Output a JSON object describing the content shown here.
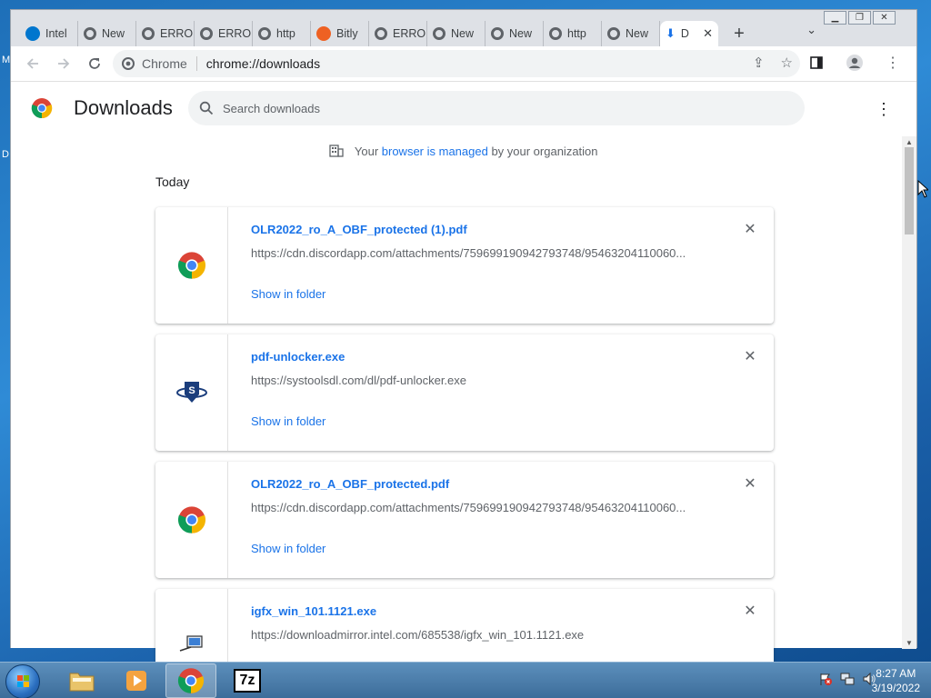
{
  "desktop": {
    "edge_labels": [
      "M",
      "D"
    ]
  },
  "window": {
    "controls": [
      "minimize",
      "maximize",
      "close"
    ],
    "tabs": [
      {
        "label": "Intel",
        "icon": "dell-icon",
        "color": "#0076ce"
      },
      {
        "label": "New",
        "icon": "chromium-icon",
        "color": "#5f6368"
      },
      {
        "label": "ERRO",
        "icon": "globe-icon",
        "color": "#5f6368"
      },
      {
        "label": "ERRO",
        "icon": "globe-icon",
        "color": "#5f6368"
      },
      {
        "label": "http",
        "icon": "globe-icon",
        "color": "#5f6368"
      },
      {
        "label": "Bitly",
        "icon": "bitly-icon",
        "color": "#ee6123"
      },
      {
        "label": "ERRO",
        "icon": "globe-icon",
        "color": "#5f6368"
      },
      {
        "label": "New",
        "icon": "chromium-icon",
        "color": "#5f6368"
      },
      {
        "label": "New",
        "icon": "chromium-icon",
        "color": "#5f6368"
      },
      {
        "label": "http",
        "icon": "globe-icon",
        "color": "#5f6368"
      },
      {
        "label": "New",
        "icon": "chromium-icon",
        "color": "#5f6368"
      }
    ],
    "active_tab": {
      "label": "D",
      "icon": "download-icon"
    },
    "new_tab_label": "+",
    "tab_search_label": "⌄"
  },
  "toolbar": {
    "omnibox": {
      "chip_label": "Chrome",
      "url": "chrome://downloads"
    }
  },
  "downloads": {
    "title": "Downloads",
    "search_placeholder": "Search downloads",
    "managed_prefix": "Your ",
    "managed_link": "browser is managed",
    "managed_suffix": " by your organization",
    "section_label": "Today",
    "items": [
      {
        "name": "OLR2022_ro_A_OBF_protected (1).pdf",
        "url": "https://cdn.discordapp.com/attachments/759699190942793748/95463204110060...",
        "action": "Show in folder",
        "icon": "chrome-icon"
      },
      {
        "name": "pdf-unlocker.exe",
        "url": "https://systoolsdl.com/dl/pdf-unlocker.exe",
        "action": "Show in folder",
        "icon": "systools-icon"
      },
      {
        "name": "OLR2022_ro_A_OBF_protected.pdf",
        "url": "https://cdn.discordapp.com/attachments/759699190942793748/95463204110060...",
        "action": "Show in folder",
        "icon": "chrome-icon"
      },
      {
        "name": "igfx_win_101.1121.exe",
        "url": "https://downloadmirror.intel.com/685538/igfx_win_101.1121.exe",
        "action": "",
        "icon": "installer-icon"
      }
    ]
  },
  "taskbar": {
    "items": [
      {
        "name": "explorer-icon"
      },
      {
        "name": "media-player-icon"
      },
      {
        "name": "chrome-icon",
        "active": true
      },
      {
        "name": "7zip-icon",
        "label": "7z"
      }
    ],
    "clock": {
      "time": "8:27 AM",
      "date": "3/19/2022"
    }
  },
  "colors": {
    "accent": "#1a73e8",
    "taskbar": "#4a7eab"
  }
}
